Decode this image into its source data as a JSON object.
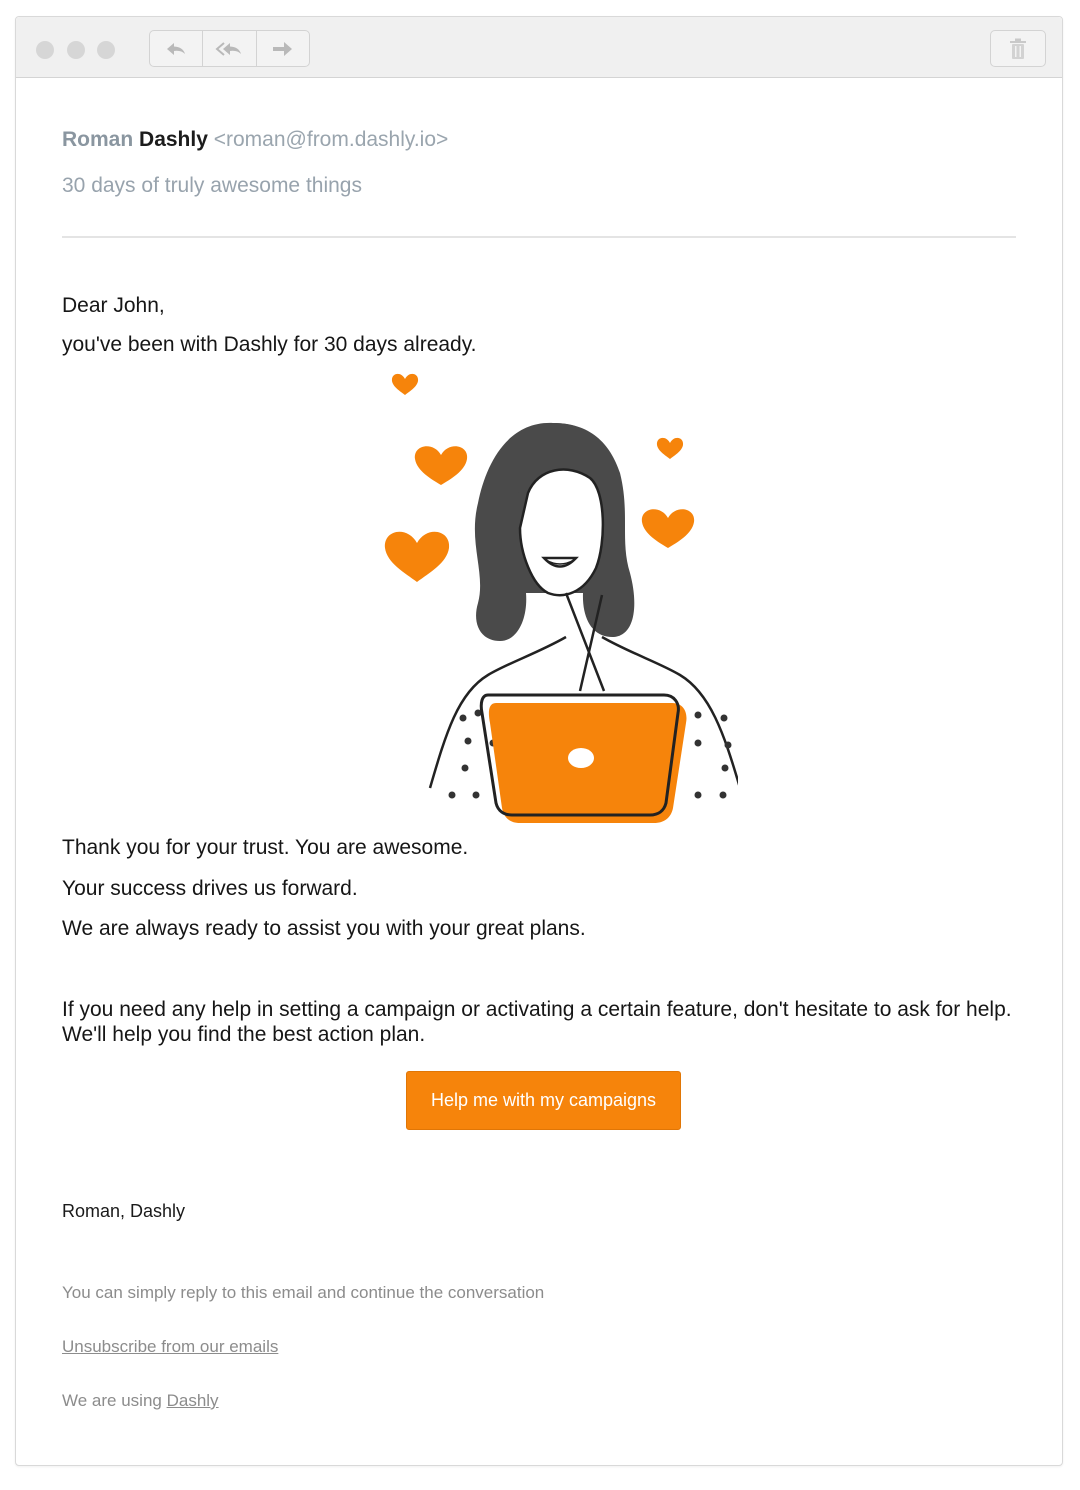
{
  "window": {
    "controls": [
      "close-dot",
      "minimize-dot",
      "zoom-dot"
    ],
    "toolbar": {
      "nav_icons": [
        "reply-icon",
        "reply-all-icon",
        "forward-icon"
      ],
      "trash_icon": "trash-icon"
    }
  },
  "email": {
    "from_first": "Roman",
    "from_last": "Dashly",
    "from_email": "<roman@from.dashly.io>",
    "subject": "30 days of truly awesome things",
    "greeting": "Dear John,",
    "intro": "you've been with Dashly for 30 days already.",
    "thanks_lines": [
      "Thank you for your trust. You are awesome.",
      "Your success drives us forward.",
      "We are always ready to assist you with your great plans."
    ],
    "help_text": "If you need any help in setting a campaign or activating a certain feature, don't hesitate to ask for help. We'll help you find the best action plan.",
    "cta_label": "Help me with my campaigns",
    "signature": "Roman, Dashly",
    "reply_note": "You can simply reply to this email and continue the conversation",
    "unsubscribe_label": "Unsubscribe from our emails",
    "using_prefix": "We are using",
    "using_link": "Dashly"
  },
  "colors": {
    "accent": "#f6840b",
    "hair": "#4a4a4a",
    "muted_text": "#8c8c8c"
  }
}
